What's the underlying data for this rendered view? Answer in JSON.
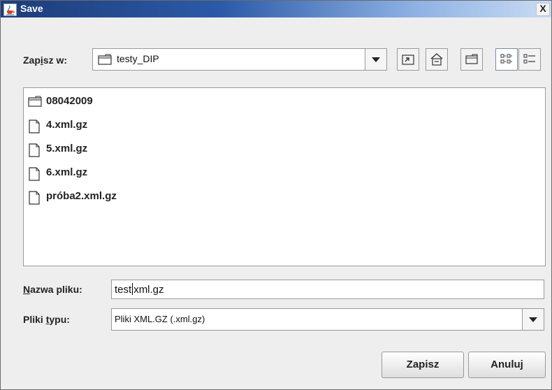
{
  "window": {
    "title": "Save",
    "close_glyph": "X",
    "title_icon": "java-cup-icon"
  },
  "lookin": {
    "label_pre": "Zap",
    "label_mnemonic": "i",
    "label_post": "sz w:",
    "folder": "testy_DIP",
    "folder_icon": "folder-icon"
  },
  "toolbar": {
    "up_icon": "up-folder-icon",
    "home_icon": "home-icon",
    "newfolder_icon": "new-folder-icon",
    "list_icon": "list-view-icon",
    "details_icon": "details-view-icon"
  },
  "files": [
    {
      "name": "08042009",
      "icon": "folder-icon"
    },
    {
      "name": "4.xml.gz",
      "icon": "file-icon"
    },
    {
      "name": "5.xml.gz",
      "icon": "file-icon"
    },
    {
      "name": "6.xml.gz",
      "icon": "file-icon"
    },
    {
      "name": "próba2.xml.gz",
      "icon": "file-icon"
    }
  ],
  "filename": {
    "label_mnemonic": "N",
    "label_post": "azwa pliku:",
    "value_before_caret": "test",
    "value_after_caret": "xml.gz"
  },
  "filetype": {
    "label_pre": "Pliki ",
    "label_mnemonic": "t",
    "label_post": "ypu:",
    "value": "Pliki XML.GZ (.xml.gz)"
  },
  "buttons": {
    "save": "Zapisz",
    "cancel": "Anuluj"
  }
}
